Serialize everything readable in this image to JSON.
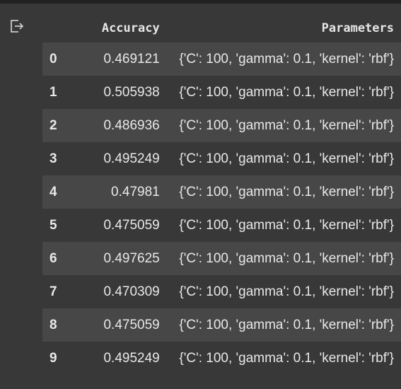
{
  "table": {
    "columns": [
      "",
      "Accuracy",
      "Parameters"
    ],
    "rows": [
      {
        "index": "0",
        "accuracy": "0.469121",
        "parameters": "{'C': 100, 'gamma': 0.1, 'kernel': 'rbf'}"
      },
      {
        "index": "1",
        "accuracy": "0.505938",
        "parameters": "{'C': 100, 'gamma': 0.1, 'kernel': 'rbf'}"
      },
      {
        "index": "2",
        "accuracy": "0.486936",
        "parameters": "{'C': 100, 'gamma': 0.1, 'kernel': 'rbf'}"
      },
      {
        "index": "3",
        "accuracy": "0.495249",
        "parameters": "{'C': 100, 'gamma': 0.1, 'kernel': 'rbf'}"
      },
      {
        "index": "4",
        "accuracy": "0.47981",
        "parameters": "{'C': 100, 'gamma': 0.1, 'kernel': 'rbf'}"
      },
      {
        "index": "5",
        "accuracy": "0.475059",
        "parameters": "{'C': 100, 'gamma': 0.1, 'kernel': 'rbf'}"
      },
      {
        "index": "6",
        "accuracy": "0.497625",
        "parameters": "{'C': 100, 'gamma': 0.1, 'kernel': 'rbf'}"
      },
      {
        "index": "7",
        "accuracy": "0.470309",
        "parameters": "{'C': 100, 'gamma': 0.1, 'kernel': 'rbf'}"
      },
      {
        "index": "8",
        "accuracy": "0.475059",
        "parameters": "{'C': 100, 'gamma': 0.1, 'kernel': 'rbf'}"
      },
      {
        "index": "9",
        "accuracy": "0.495249",
        "parameters": "{'C': 100, 'gamma': 0.1, 'kernel': 'rbf'}"
      }
    ]
  },
  "icons": {
    "output": "output-cell-icon"
  },
  "colors": {
    "background": "#383838",
    "row_stripe": "#474747",
    "text": "#e8e8e8"
  }
}
